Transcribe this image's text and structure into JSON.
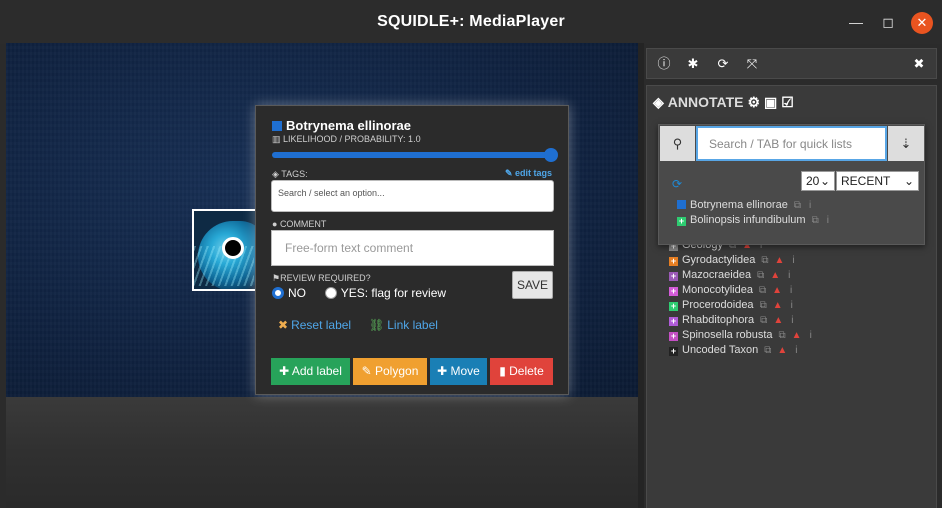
{
  "window": {
    "title": "SQUIDLE+: MediaPlayer",
    "min": "—",
    "max": "◻",
    "close": "✕"
  },
  "popup": {
    "label_name": "Botrynema ellinorae",
    "label_color": "#1f6fd1",
    "likelihood_label": "LIKELIHOOD / PROBABILITY: 1.0",
    "likelihood_value": 1.0,
    "tags_label": "TAGS:",
    "edit_tags": "edit tags",
    "tags_placeholder": "Search / select an option...",
    "comment_label": "COMMENT",
    "comment_placeholder": "Free-form text comment",
    "review_label": "REVIEW REQUIRED?",
    "review_no": "NO",
    "review_yes": "YES: flag for review",
    "review_selected": "NO",
    "save": "SAVE",
    "reset_label": "Reset label",
    "link_label": "Link label",
    "btn_add": "Add label",
    "btn_polygon": "Polygon",
    "btn_move": "Move",
    "btn_delete": "Delete"
  },
  "panel": {
    "heading": "ANNOTATE",
    "search_placeholder": "Search / TAB for quick lists",
    "count": "20",
    "mode": "RECENT",
    "recent": [
      {
        "name": "Botrynema ellinorae",
        "color": "#1f6fd1",
        "glyph": ""
      },
      {
        "name": "Bolinopsis infundibulum",
        "color": "#2ecc71",
        "glyph": "+"
      }
    ],
    "tree": [
      {
        "name": "Geology",
        "color": "#888888",
        "warn": true
      },
      {
        "name": "Gyrodactylidea",
        "color": "#e67e22",
        "warn": true
      },
      {
        "name": "Mazocraeidea",
        "color": "#9b59b6",
        "warn": true
      },
      {
        "name": "Monocotylidea",
        "color": "#d35bd8",
        "warn": true
      },
      {
        "name": "Procerodoidea",
        "color": "#2ecc71",
        "warn": true
      },
      {
        "name": "Rhabditophora",
        "color": "#b05bd8",
        "warn": true
      },
      {
        "name": "Spinosella robusta",
        "color": "#c44fc4",
        "warn": true
      },
      {
        "name": "Uncoded Taxon",
        "color": "#222222",
        "warn": true
      }
    ]
  }
}
